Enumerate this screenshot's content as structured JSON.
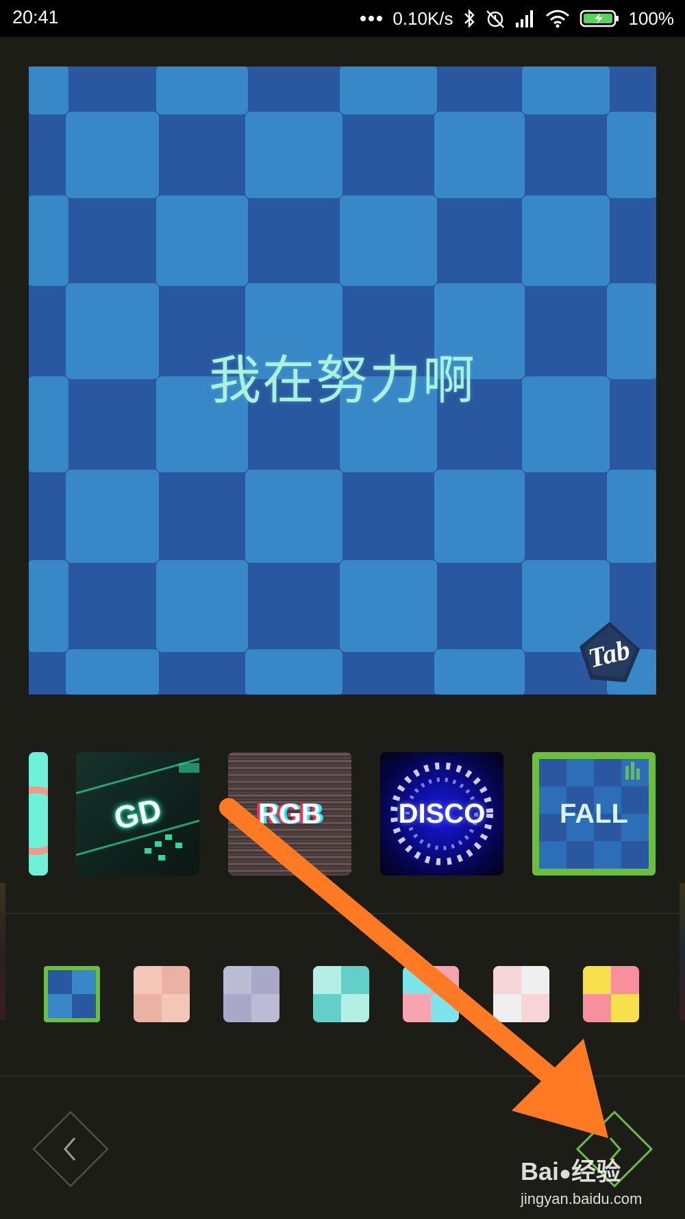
{
  "status_bar": {
    "time": "20:41",
    "more_icon": "dots-icon",
    "network_speed": "0.10K/s",
    "battery_percent": "100%",
    "icons": [
      "bluetooth-icon",
      "alarm-off-icon",
      "signal-icon",
      "wifi-icon",
      "battery-charging-icon"
    ]
  },
  "preview": {
    "caption": "我在努力啊",
    "watermark_logo": "Tab",
    "colors": {
      "light": "#3887c6",
      "dark": "#2a58a0",
      "text": "#a8f2de"
    }
  },
  "effects": {
    "items": [
      {
        "id": "partial",
        "label": ""
      },
      {
        "id": "gd",
        "label": "GD"
      },
      {
        "id": "rgb",
        "label": "RGB"
      },
      {
        "id": "disco",
        "label": "DISCO"
      },
      {
        "id": "fall",
        "label": "FALL",
        "selected": true
      }
    ]
  },
  "palettes": {
    "items": [
      {
        "colors": [
          "#2a58a0",
          "#3887c6",
          "#3887c6",
          "#2a58a0"
        ],
        "selected": true
      },
      {
        "colors": [
          "#f3c7b8",
          "#ebb2a3",
          "#ebb2a3",
          "#f3c7b8"
        ]
      },
      {
        "colors": [
          "#bcbbd4",
          "#a9a8c9",
          "#a9a8c9",
          "#bcbbd4"
        ]
      },
      {
        "colors": [
          "#b4efe6",
          "#62d0c8",
          "#62d0c8",
          "#b4efe6"
        ]
      },
      {
        "colors": [
          "#7fe3ea",
          "#f7a3b0",
          "#f7a3b0",
          "#7fe3ea"
        ]
      },
      {
        "colors": [
          "#f7d4d6",
          "#efefef",
          "#efefef",
          "#f7d4d6"
        ]
      },
      {
        "colors": [
          "#f7e04c",
          "#f7909c",
          "#f7909c",
          "#f7e04c"
        ]
      }
    ],
    "accent": "#6abf3c"
  },
  "navigation": {
    "back_icon": "chevron-left-icon",
    "next_icon": "chevron-right-icon"
  },
  "overlay": {
    "annotation_arrow_color": "#ff7a22",
    "watermark_brand": "Bai",
    "watermark_brand_suffix": "经验",
    "watermark_url": "jingyan.baidu.com"
  }
}
